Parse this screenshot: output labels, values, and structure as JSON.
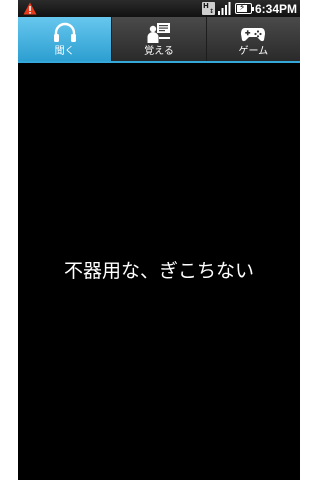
{
  "status_bar": {
    "warning_icon": "warning-triangle-icon",
    "network_icon": "hsdpa-icon",
    "network_label": "H",
    "signal_icon": "signal-bars-icon",
    "battery_icon": "battery-charging-icon",
    "time": "6:34PM"
  },
  "tabs": [
    {
      "label": "聞く",
      "icon": "headphones-icon",
      "active": true
    },
    {
      "label": "覚える",
      "icon": "study-icon",
      "active": false
    },
    {
      "label": "ゲーム",
      "icon": "gamepad-icon",
      "active": false
    }
  ],
  "colors": {
    "accent": "#35a7d8",
    "active_tab_top": "#67c7ee",
    "active_tab_bottom": "#2d9fd1",
    "warning": "#e83b1c",
    "background": "#000000"
  },
  "main": {
    "phrase": "不器用な、ぎこちない"
  }
}
